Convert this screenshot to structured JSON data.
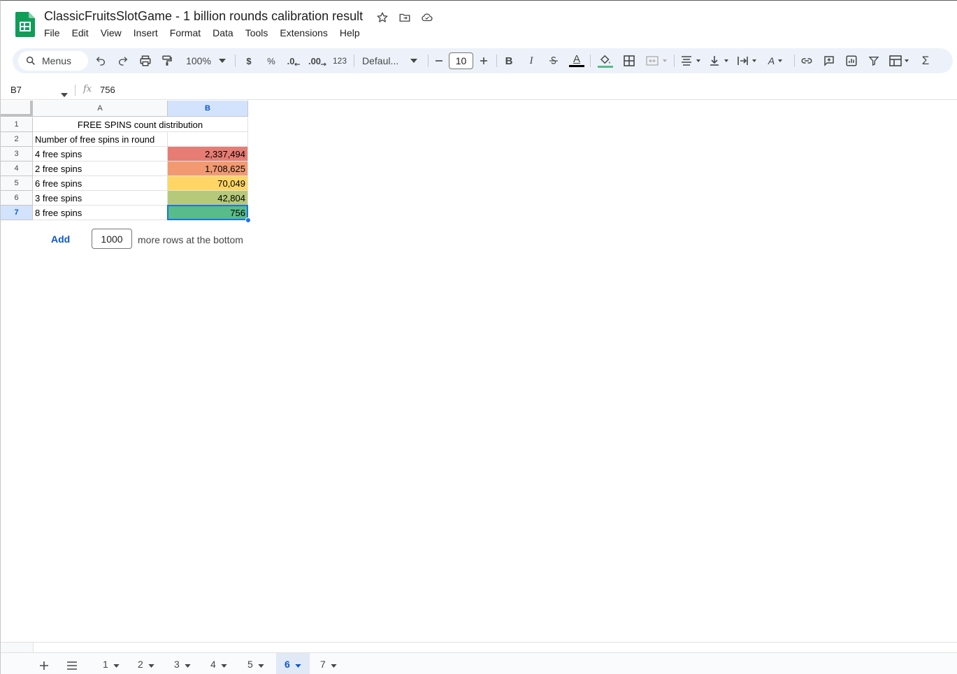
{
  "doc": {
    "title": "ClassicFruitsSlotGame - 1 billion rounds calibration result"
  },
  "menu": [
    "File",
    "Edit",
    "View",
    "Insert",
    "Format",
    "Data",
    "Tools",
    "Extensions",
    "Help"
  ],
  "toolbar": {
    "menus_label": "Menus",
    "zoom": "100%",
    "currency": "$",
    "percent": "%",
    "dec_decrease": ".0",
    "dec_increase": ".00",
    "number_format": "123",
    "font": "Defaul...",
    "font_size": "10",
    "bold": "B",
    "italic": "I",
    "text_color_glyph": "A",
    "text_rotation_glyph": "A",
    "sum": "Σ"
  },
  "formula_bar": {
    "cell_ref": "B7",
    "fx": "fx",
    "value": "756"
  },
  "grid": {
    "columns": [
      "A",
      "B"
    ],
    "rows": [
      {
        "num": "1",
        "a": "FREE SPINS count distribution",
        "b": ""
      },
      {
        "num": "2",
        "a": "Number of free spins in round",
        "b": ""
      },
      {
        "num": "3",
        "a": "4 free spins",
        "b": "2,337,494",
        "color": "#e67c73"
      },
      {
        "num": "4",
        "a": "2 free spins",
        "b": "1,708,625",
        "color": "#f19a72"
      },
      {
        "num": "5",
        "a": "6 free spins",
        "b": "70,049",
        "color": "#ffd666"
      },
      {
        "num": "6",
        "a": "3 free spins",
        "b": "42,804",
        "color": "#b6c97a"
      },
      {
        "num": "7",
        "a": "8 free spins",
        "b": "756",
        "color": "#57bb8a"
      }
    ]
  },
  "add_rows": {
    "button": "Add",
    "count": "1000",
    "suffix": "more rows at the bottom"
  },
  "sheets": [
    "1",
    "2",
    "3",
    "4",
    "5",
    "6",
    "7"
  ],
  "active_sheet": "6",
  "colors": {
    "accent": "#0b57d0",
    "selection": "#1a73e8",
    "toolbar_bg": "#edf2fa",
    "logo_green": "#0f9d58"
  }
}
